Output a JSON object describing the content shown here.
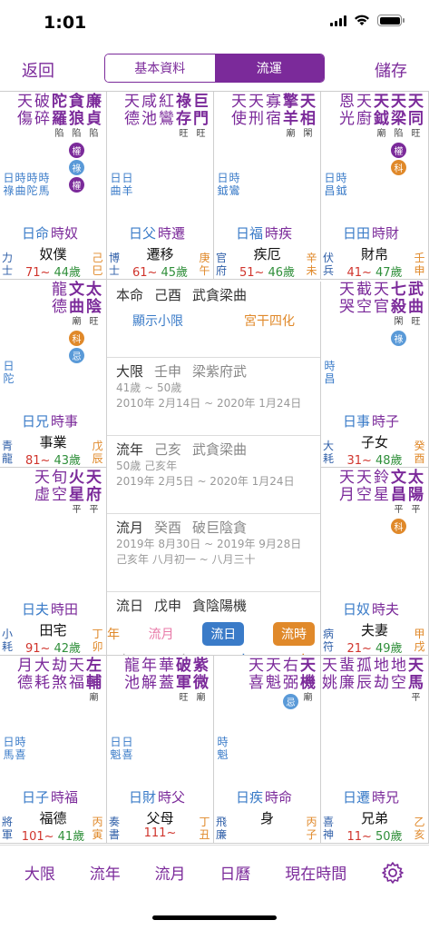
{
  "status": {
    "time": "1:01"
  },
  "nav": {
    "back": "返回",
    "save": "儲存",
    "seg": [
      "基本資料",
      "流運"
    ]
  },
  "colors": {
    "accent": "#7b2a9a",
    "lu": "#5a9ad8",
    "quan": "#7b2a9a",
    "ke": "#e0892a",
    "ji": "#5a9ad8"
  },
  "cells": [
    {
      "id": "nupu",
      "cols": [
        [
          "貪",
          "陷"
        ],
        [
          "廉",
          "陷"
        ]
      ],
      "main": [
        "破",
        "碎"
      ],
      "minor": [
        [
          "天",
          "傷"
        ],
        [
          "破",
          "碎"
        ],
        [
          "陀",
          "羅"
        ]
      ],
      "hua": [
        "權",
        "祿",
        "權"
      ],
      "small": [
        [
          "日",
          "祿"
        ],
        [
          "時",
          "曲"
        ],
        [
          "時",
          "陀"
        ],
        [
          "祿",
          "馬"
        ]
      ],
      "lbl": [
        "日命",
        "時奴"
      ],
      "name": "奴僕",
      "age1": "71~",
      "age2": "44歲",
      "l": [
        "力",
        "士"
      ],
      "r": [
        "己",
        "巳"
      ]
    }
  ],
  "palaces": [
    {
      "stars": "天破陀貪廉/傷碎羅狼貞",
      "bright": "陷陷陷",
      "small": "日時時時/祿曲陀馬",
      "tag1": "日命",
      "tag2": "時奴",
      "name": "奴僕",
      "age1": "71~",
      "age2": "44歲",
      "l": "力士",
      "r": "己巳",
      "hua": [
        "權",
        "祿",
        "權"
      ]
    },
    {
      "stars": "天咸紅祿巨/德池鸞存門",
      "bright": "旺旺",
      "small": "日日/曲羊",
      "tag1": "日父",
      "tag2": "時遷",
      "name": "遷移",
      "age1": "61~",
      "age2": "45歲",
      "l": "博士",
      "r": "庚午",
      "hua": []
    },
    {
      "stars": "天天寡擎天/使刑宿羊相",
      "bright": "廟閑",
      "small": "日時/鉞鸞",
      "tag1": "日福",
      "tag2": "時疾",
      "name": "疾厄",
      "age1": "51~",
      "age2": "46歲",
      "l": "官府",
      "r": "辛未",
      "hua": []
    },
    {
      "stars": "恩天天天天/光廚鉞梁同",
      "bright": "廟陷旺",
      "small": "日時/昌鉞",
      "tag1": "日田",
      "tag2": "時財",
      "name": "財帛",
      "age1": "41~",
      "age2": "47歲",
      "l": "伏兵",
      "r": "壬申",
      "hua": [
        "權",
        "科"
      ]
    },
    {
      "stars": "龍文太/德曲陰",
      "bright": "廟旺",
      "small": "日/陀",
      "tag1": "日兄",
      "tag2": "時事",
      "name": "事業",
      "age1": "81~",
      "age2": "43歲",
      "l": "青龍",
      "r": "戊辰",
      "hua": [
        "科",
        "忌"
      ]
    },
    {
      "stars": "天截天七武/哭空官殺曲",
      "bright": "閑旺",
      "small": "時/昌",
      "tag1": "日事",
      "tag2": "時子",
      "name": "子女",
      "age1": "31~",
      "age2": "48歲",
      "l": "大耗",
      "r": "癸酉",
      "hua": [
        "祿"
      ]
    },
    {
      "stars": "天旬火天/虛空星府",
      "bright": "平平",
      "small": "",
      "tag1": "",
      "tag2": "",
      "name": "",
      "age1": "",
      "age2": "",
      "l": "",
      "r": "",
      "hua": []
    },
    {
      "stars": "天天鈴文太/月空星昌陽",
      "bright": "平平",
      "small": "",
      "tag1": "",
      "tag2": "",
      "name": "",
      "age1": "",
      "age2": "",
      "l": "",
      "r": "",
      "hua": [
        "科"
      ]
    },
    {
      "stars": "",
      "bright": "",
      "small": "",
      "tag1": "日夫",
      "tag2": "時田",
      "name": "田宅",
      "age1": "91~",
      "age2": "42歲",
      "l": "小耗",
      "r": "丁卯",
      "hua": []
    },
    {
      "stars": "",
      "bright": "",
      "small": "",
      "tag1": "日奴",
      "tag2": "時夫",
      "name": "夫妻",
      "age1": "21~",
      "age2": "49歲",
      "l": "病符",
      "r": "甲戌",
      "hua": []
    },
    {
      "stars": "月大劫天左/德耗煞福輔",
      "bright": "廟",
      "small": "日時/馬喜",
      "tag1": "日子",
      "tag2": "時福",
      "name": "福德",
      "age1": "101~",
      "age2": "41歲",
      "l": "將軍",
      "r": "丙寅",
      "hua": []
    },
    {
      "stars": "龍年華破紫/池解蓋軍微",
      "bright": "旺廟",
      "small": "日日/魁喜",
      "tag1": "日財",
      "tag2": "時父",
      "name": "父母",
      "age1": "111~",
      "age2": "",
      "l": "奏書",
      "r": "丁丑",
      "hua": []
    },
    {
      "stars": "天天右天/喜魁弼機",
      "bright": "廟",
      "small": "時/魁",
      "tag1": "日疾",
      "tag2": "時命",
      "name": "身",
      "age1": "",
      "age2": "",
      "l": "飛廉",
      "r": "丙子",
      "hua": [
        "忌"
      ]
    },
    {
      "stars": "天蜚孤地地天/姚廉辰劫空馬",
      "bright": "平",
      "small": "",
      "tag1": "日遷",
      "tag2": "時兄",
      "name": "兄弟",
      "age1": "11~",
      "age2": "50歲",
      "l": "喜神",
      "r": "乙亥",
      "hua": []
    }
  ],
  "center": {
    "benming": {
      "label": "本命",
      "gz": "己酉",
      "stars": "武貪梁曲",
      "btn1": "顯示小限",
      "btn2": "宮干四化"
    },
    "daxian": {
      "label": "大限",
      "gz": "壬申",
      "stars": "梁紫府武",
      "age": "41歲 ~ 50歲",
      "range": "2010年 2月14日 ~ 2020年 1月24日"
    },
    "liunian": {
      "label": "流年",
      "gz": "己亥",
      "stars": "武貪梁曲",
      "age": "50歲 己亥年",
      "range": "2019年 2月5日 ~ 2020年 1月24日"
    },
    "liuyue": {
      "label": "流月",
      "gz": "癸酉",
      "stars": "破巨陰貪",
      "range": "2019年 8月30日 ~ 2019年 9月28日",
      "lunar": "己亥年 八月初一 ~ 八月三十"
    },
    "liuri": {
      "label": "流日",
      "gz": "戊申",
      "stars": "貪陰陽機"
    },
    "buttons": {
      "nian": "年",
      "yue": "流月",
      "ri": "流日",
      "shi": "流時"
    },
    "steppers": [
      "+",
      "-",
      "+",
      "-",
      "+",
      "-",
      "+"
    ]
  },
  "tabbar": [
    "大限",
    "流年",
    "流月",
    "日曆",
    "現在時間"
  ],
  "tabbar_icon": "gear-icon"
}
